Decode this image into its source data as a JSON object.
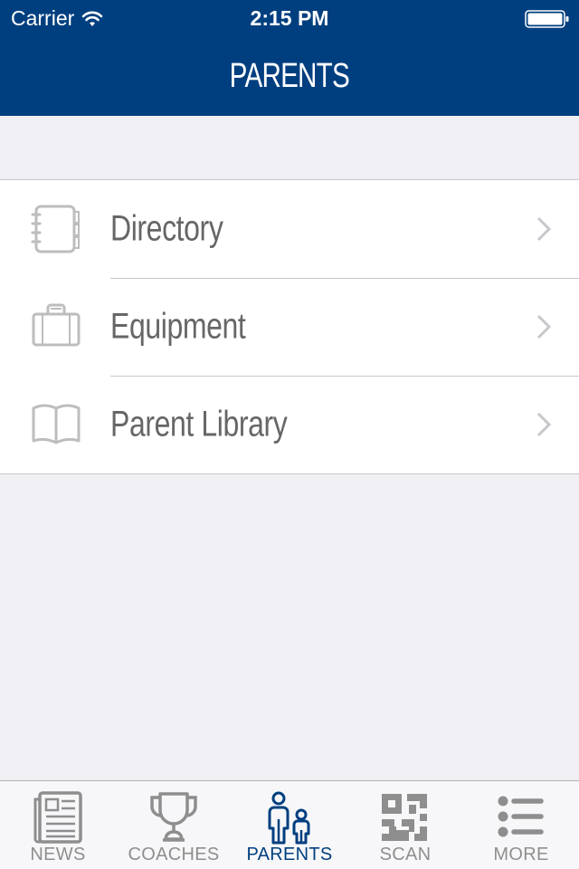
{
  "status_bar": {
    "carrier": "Carrier",
    "time": "2:15 PM",
    "wifi_icon": "wifi-icon",
    "battery_icon": "battery-full-icon"
  },
  "nav": {
    "title": "PARENTS"
  },
  "list": {
    "items": [
      {
        "label": "Directory",
        "icon": "address-book-icon"
      },
      {
        "label": "Equipment",
        "icon": "briefcase-icon"
      },
      {
        "label": "Parent Library",
        "icon": "open-book-icon"
      }
    ]
  },
  "tabs": [
    {
      "label": "NEWS",
      "icon": "newspaper-icon",
      "active": false
    },
    {
      "label": "COACHES",
      "icon": "trophy-icon",
      "active": false
    },
    {
      "label": "PARENTS",
      "icon": "parents-icon",
      "active": true
    },
    {
      "label": "SCAN",
      "icon": "qr-code-icon",
      "active": false
    },
    {
      "label": "MORE",
      "icon": "list-icon",
      "active": false
    }
  ],
  "colors": {
    "brand": "#003f7f",
    "background": "#efeff4",
    "text_gray": "#666666",
    "icon_gray": "#bdbdbd",
    "tab_inactive": "#8e8e8e"
  }
}
